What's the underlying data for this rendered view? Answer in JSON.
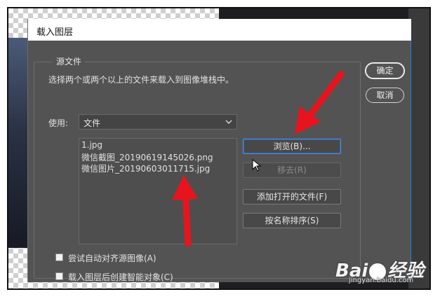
{
  "dialog": {
    "title": "载入图层",
    "source_group_label": "源文件",
    "description": "选择两个或两个以上的文件来载入到图像堆栈中。",
    "use_label": "使用:",
    "use_select": {
      "value": "文件",
      "icon": "chevron-down-icon"
    },
    "file_list": [
      "1.jpg",
      "微信截图_20190619145026.png",
      "微信图片_20190603011715.jpg"
    ],
    "buttons": {
      "browse": "浏览(B)...",
      "remove": "移去(R)",
      "add_open": "添加打开的文件(F)",
      "sort_by_name": "按名称排序(S)",
      "ok": "确定",
      "cancel": "取消"
    },
    "checkboxes": [
      {
        "label": "尝试自动对齐源图像(A)",
        "checked": false
      },
      {
        "label": "载入图层后创建智能对象(C)",
        "checked": false
      }
    ]
  },
  "watermark": {
    "logo": "Bai 经验",
    "url": "jingyan.baidu.com"
  },
  "colors": {
    "dialog_bg": "#535353",
    "arrow": "#e8141d",
    "focus": "#4f8fe0"
  }
}
